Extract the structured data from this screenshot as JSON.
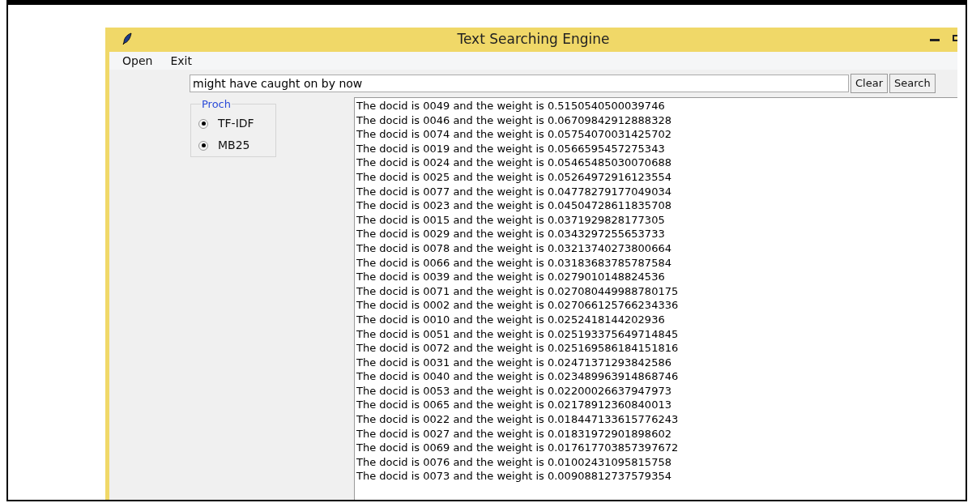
{
  "window": {
    "title": "Text Searching Engine"
  },
  "menu": [
    "Open",
    "Exit"
  ],
  "search": {
    "value": "might have caught on by now"
  },
  "buttons": [
    "Clear",
    "Search"
  ],
  "approach": {
    "title": "Proch",
    "options": [
      {
        "label": "TF-IDF",
        "selected": true
      },
      {
        "label": "MB25",
        "selected": true
      }
    ]
  },
  "results": [
    "The docid is 0049 and the weight is 0.5150540500039746",
    "The docid is 0046 and the weight is 0.06709842912888328",
    "The docid is 0074 and the weight is 0.05754070031425702",
    "The docid is 0019 and the weight is 0.0566595457275343",
    "The docid is 0024 and the weight is 0.05465485030070688",
    "The docid is 0025 and the weight is 0.05264972916123554",
    "The docid is 0077 and the weight is 0.04778279177049034",
    "The docid is 0023 and the weight is 0.04504728611835708",
    "The docid is 0015 and the weight is 0.0371929828177305",
    "The docid is 0029 and the weight is 0.0343297255653733",
    "The docid is 0078 and the weight is 0.03213740273800664",
    "The docid is 0066 and the weight is 0.03183683785787584",
    "The docid is 0039 and the weight is 0.0279010148824536",
    "The docid is 0071 and the weight is 0.027080449988780175",
    "The docid is 0002 and the weight is 0.027066125766234336",
    "The docid is 0010 and the weight is 0.0252418144202936",
    "The docid is 0051 and the weight is 0.025193375649714845",
    "The docid is 0072 and the weight is 0.025169586184151816",
    "The docid is 0031 and the weight is 0.02471371293842586",
    "The docid is 0040 and the weight is 0.023489963914868746",
    "The docid is 0053 and the weight is 0.02200026637947973",
    "The docid is 0065 and the weight is 0.02178912360840013",
    "The docid is 0022 and the weight is 0.018447133615776243",
    "The docid is 0027 and the weight is 0.01831972901898602",
    "The docid is 0069 and the weight is 0.017617703857397672",
    "The docid is 0076 and the weight is 0.01002431095815758",
    "The docid is 0073 and the weight is 0.00908812737579354"
  ]
}
